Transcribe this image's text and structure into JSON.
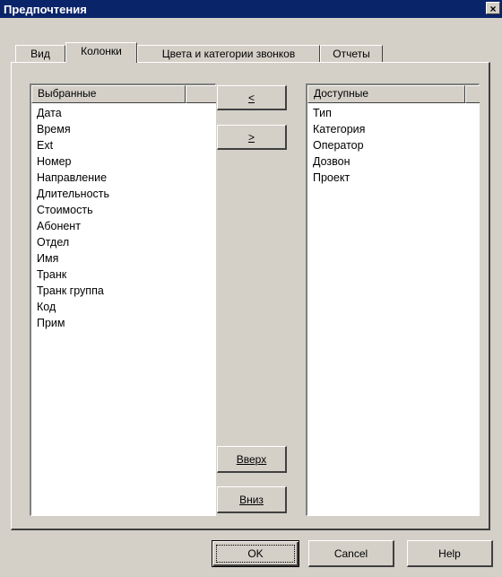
{
  "window": {
    "title": "Предпочтения",
    "close_label": "×"
  },
  "tabs": [
    {
      "label": "Вид"
    },
    {
      "label": "Колонки"
    },
    {
      "label": "Цвета и категории звонков"
    },
    {
      "label": "Отчеты"
    }
  ],
  "selected_list": {
    "header": "Выбранные",
    "items": [
      "Дата",
      "Время",
      "Ext",
      "Номер",
      "Направление",
      "Длительность",
      "Стоимость",
      "Абонент",
      "Отдел",
      "Имя",
      "Транк",
      "Транк группа",
      "Код",
      "Прим"
    ]
  },
  "available_list": {
    "header": "Доступные",
    "items": [
      "Тип",
      "Категория",
      "Оператор",
      "Дозвон",
      "Проект"
    ]
  },
  "buttons": {
    "move_left": "<",
    "move_right": ">",
    "up": "Вверх",
    "down": "Вниз",
    "ok": "OK",
    "cancel": "Cancel",
    "help": "Help"
  }
}
